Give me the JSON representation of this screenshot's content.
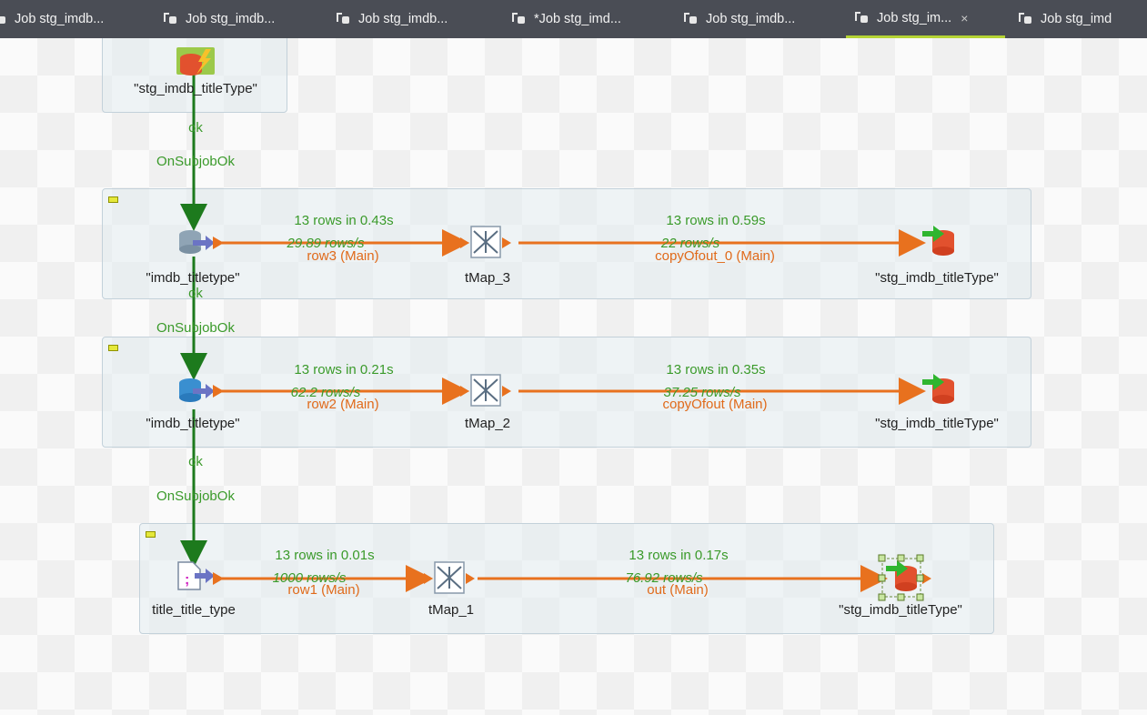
{
  "tabs": [
    {
      "label": "Job stg_imdb...",
      "active": false
    },
    {
      "label": "Job stg_imdb...",
      "active": false
    },
    {
      "label": "Job stg_imdb...",
      "active": false
    },
    {
      "label": "*Job stg_imd...",
      "active": false
    },
    {
      "label": "Job stg_imdb...",
      "active": false
    },
    {
      "label": "Job stg_im...",
      "active": true,
      "close": "×"
    },
    {
      "label": "Job stg_imd",
      "active": false
    }
  ],
  "top_component": {
    "label": "\"stg_imdb_titleType\""
  },
  "triggers": {
    "t1": {
      "ok": "ok",
      "onsubjob": "OnSubjobOk"
    },
    "t2": {
      "ok": "ok",
      "onsubjob": "OnSubjobOk"
    },
    "t3": {
      "ok": "ok",
      "onsubjob": "OnSubjobOk"
    }
  },
  "subjob1": {
    "input_label": "\"imdb_titletype\"",
    "map_label": "tMap_3",
    "output_label": "\"stg_imdb_titleType\"",
    "link1": {
      "stat": "13 rows in 0.43s",
      "rate": "29.89 rows/s",
      "name": "row3 (Main)"
    },
    "link2": {
      "stat": "13 rows in 0.59s",
      "rate": "22 rows/s",
      "name": "copyOfout_0 (Main)"
    }
  },
  "subjob2": {
    "input_label": "\"imdb_titletype\"",
    "map_label": "tMap_2",
    "output_label": "\"stg_imdb_titleType\"",
    "link1": {
      "stat": "13 rows in 0.21s",
      "rate": "62.2 rows/s",
      "name": "row2 (Main)"
    },
    "link2": {
      "stat": "13 rows in 0.35s",
      "rate": "37.25 rows/s",
      "name": "copyOfout (Main)"
    }
  },
  "subjob3": {
    "input_label": "title_title_type",
    "map_label": "tMap_1",
    "output_label": "\"stg_imdb_titleType\"",
    "link1": {
      "stat": "13 rows in 0.01s",
      "rate": "1000 rows/s",
      "name": "row1 (Main)"
    },
    "link2": {
      "stat": "13 rows in 0.17s",
      "rate": "76.92 rows/s",
      "name": "out (Main)"
    }
  },
  "colors": {
    "main_link": "#e8711e",
    "trigger_link": "#1d7a1d",
    "stats_text": "#3a9a2a",
    "active_tab_underline": "#b5d334"
  }
}
